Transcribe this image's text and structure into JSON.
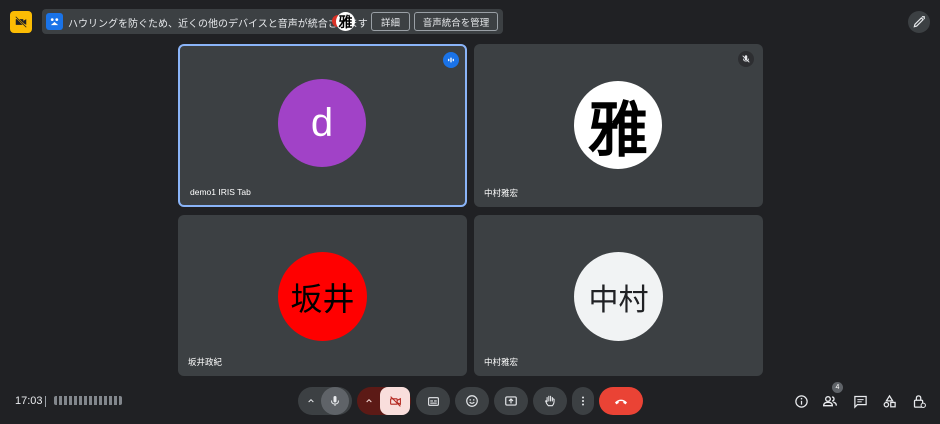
{
  "banner": {
    "message": "ハウリングを防ぐため、近くの他のデバイスと音声が統合されます",
    "details_label": "詳細",
    "manage_label": "音声統合を管理",
    "avatar_glyph": "雅"
  },
  "participants": [
    {
      "name": "demo1 IRIS Tab",
      "avatar_text": "d",
      "avatar_color": "#a142c7",
      "avatar_text_color": "#ffffff",
      "status": "speaking",
      "active": true
    },
    {
      "name": "中村雅宏",
      "avatar_text": "雅",
      "avatar_color": "#ffffff",
      "avatar_text_color": "#000000",
      "status": "muted",
      "active": false
    },
    {
      "name": "坂井政紀",
      "avatar_text": "坂井",
      "avatar_color": "#ff0000",
      "avatar_text_color": "#000000",
      "status": "",
      "active": false
    },
    {
      "name": "中村雅宏",
      "avatar_text": "中村",
      "avatar_color": "#f1f3f4",
      "avatar_text_color": "#202124",
      "status": "",
      "active": false
    }
  ],
  "meeting": {
    "time": "17:03",
    "people_count": "4"
  },
  "colors": {
    "background": "#202124",
    "tile": "#3c4043",
    "active_border": "#8ab4f8",
    "end_call": "#ea4335",
    "camera_off": "#f9dedc",
    "warning": "#fbbc04"
  },
  "icons": [
    "camera-off-warning-icon",
    "audio-merge-icon",
    "pen-icon",
    "mic-icon",
    "camera-off-icon",
    "captions-icon",
    "emoji-icon",
    "present-icon",
    "raise-hand-icon",
    "more-icon",
    "end-call-icon",
    "info-icon",
    "people-icon",
    "chat-icon",
    "activities-icon",
    "host-controls-icon"
  ]
}
